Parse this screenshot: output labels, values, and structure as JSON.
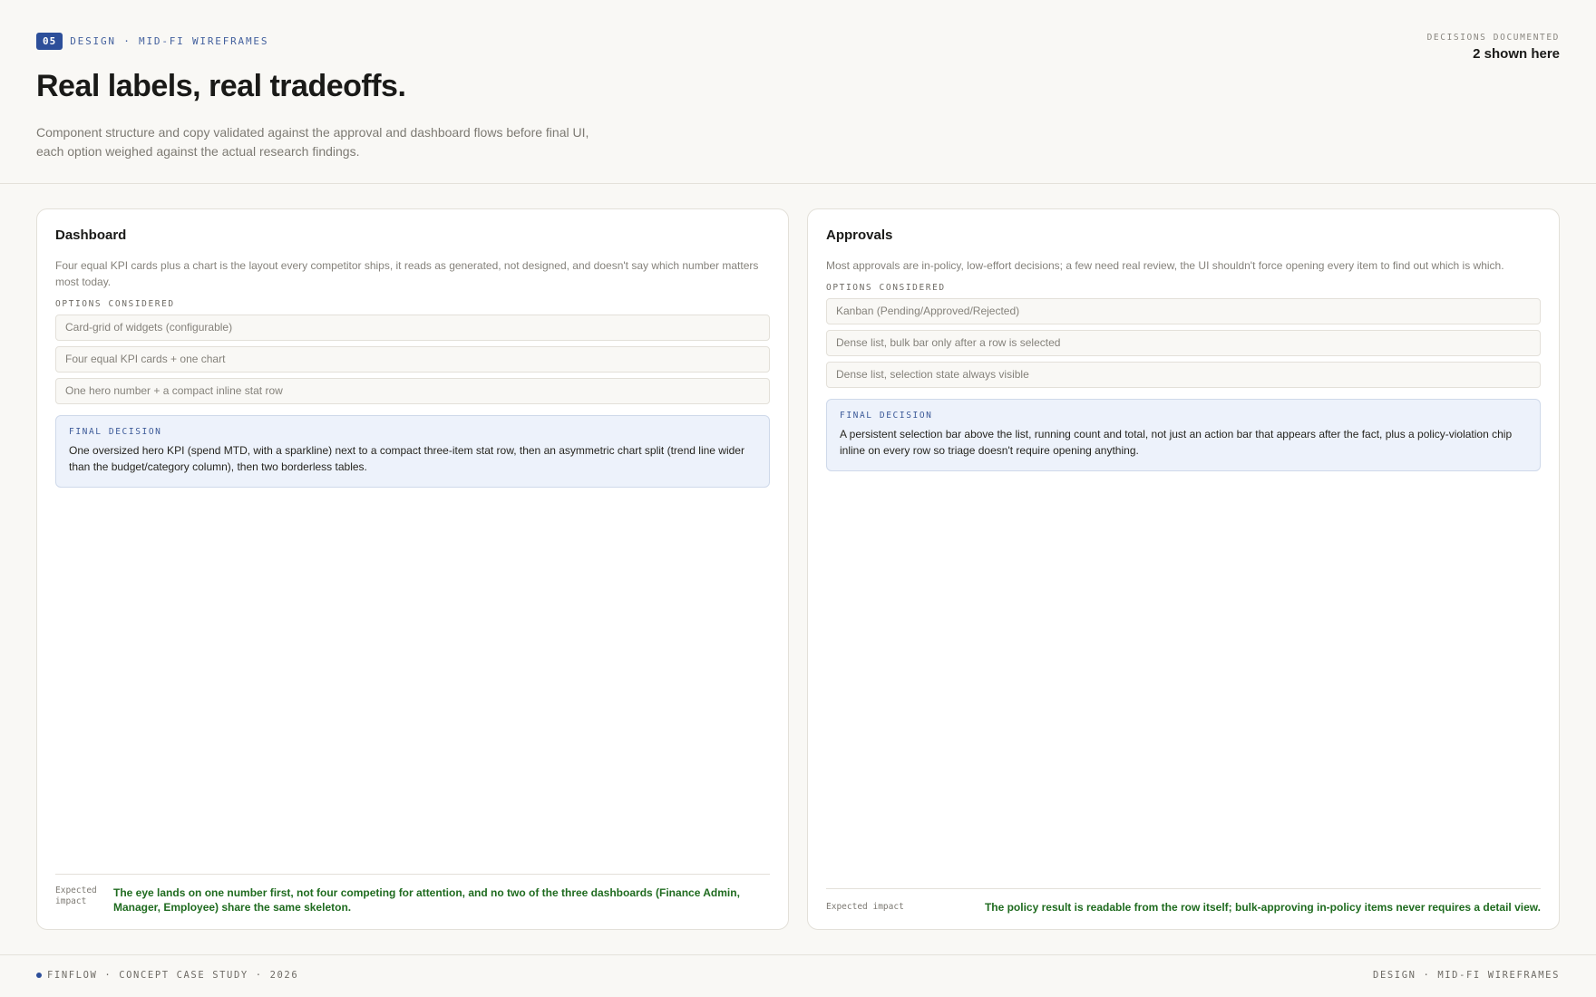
{
  "header": {
    "badge": "05",
    "eyebrow": "DESIGN · MID-FI WIREFRAMES",
    "title": "Real labels, real tradeoffs.",
    "subtitle": "Component structure and copy validated against the approval and dashboard flows before final UI, each option weighed against the actual research findings.",
    "meta_label": "DECISIONS DOCUMENTED",
    "meta_value": "2 shown here"
  },
  "cards": [
    {
      "title": "Dashboard",
      "description": "Four equal KPI cards plus a chart is the layout every competitor ships, it reads as generated, not designed, and doesn't say which number matters most today.",
      "options_label": "OPTIONS CONSIDERED",
      "options": [
        "Card-grid of widgets (configurable)",
        "Four equal KPI cards + one chart",
        "One hero number + a compact inline stat row"
      ],
      "decision_label": "FINAL DECISION",
      "decision": "One oversized hero KPI (spend MTD, with a sparkline) next to a compact three-item stat row, then an asymmetric chart split (trend line wider than the budget/category column), then two borderless tables.",
      "impact_label": "Expected impact",
      "impact": "The eye lands on one number first, not four competing for attention, and no two of the three dashboards (Finance Admin, Manager, Employee) share the same skeleton."
    },
    {
      "title": "Approvals",
      "description": "Most approvals are in-policy, low-effort decisions; a few need real review, the UI shouldn't force opening every item to find out which is which.",
      "options_label": "OPTIONS CONSIDERED",
      "options": [
        "Kanban (Pending/Approved/Rejected)",
        "Dense list, bulk bar only after a row is selected",
        "Dense list, selection state always visible"
      ],
      "decision_label": "FINAL DECISION",
      "decision": "A persistent selection bar above the list, running count and total, not just an action bar that appears after the fact, plus a policy-violation chip inline on every row so triage doesn't require opening anything.",
      "impact_label": "Expected impact",
      "impact": "The policy result is readable from the row itself; bulk-approving in-policy items never requires a detail view."
    }
  ],
  "footer": {
    "left": "FINFLOW · CONCEPT CASE STUDY · 2026",
    "right": "DESIGN · MID-FI WIREFRAMES"
  }
}
